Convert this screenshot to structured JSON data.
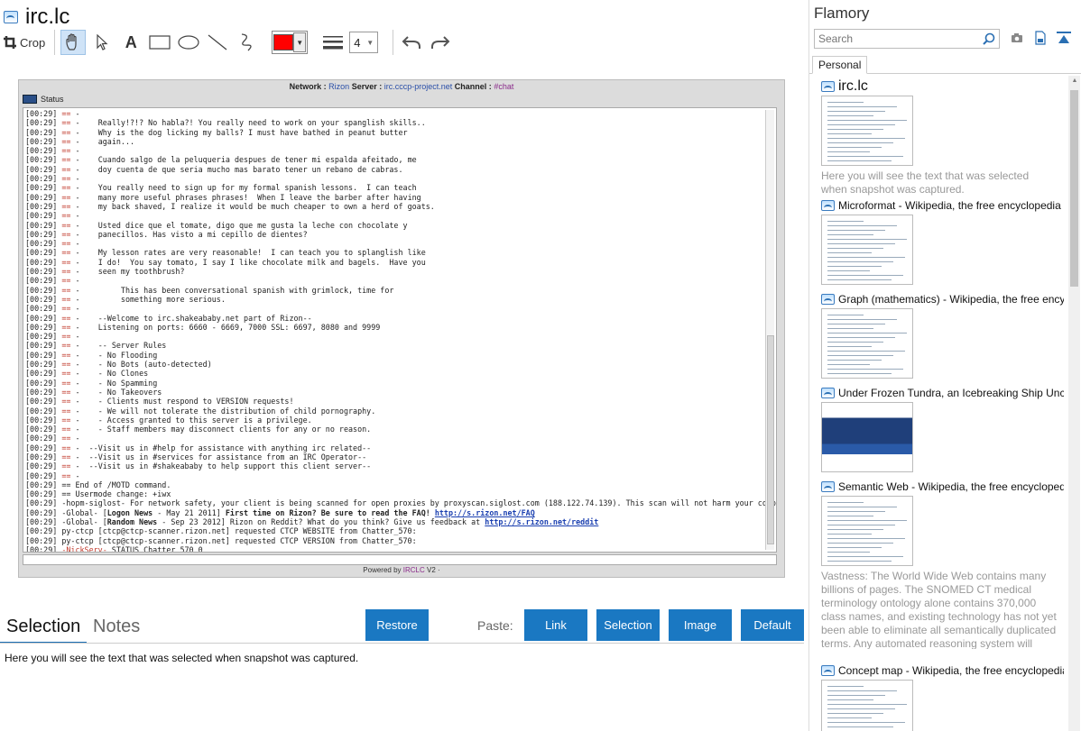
{
  "doc": {
    "title": "irc.lc"
  },
  "toolbar": {
    "crop_label": "Crop",
    "line_width": "4",
    "color": "#ff0000"
  },
  "screenshot": {
    "header": {
      "network_label": "Network :",
      "network": "Rizon",
      "server_label": "Server :",
      "server": "irc.cccp-project.net",
      "channel_label": "Channel :",
      "channel": "#chat"
    },
    "tab_status": "Status",
    "footer_prefix": "Powered by",
    "footer_brand": "IRCLC",
    "footer_suffix": "V2 ·",
    "lines": [
      {
        "t": "[00:29] ",
        "e": "== ",
        "x": "-"
      },
      {
        "t": "[00:29] ",
        "e": "== ",
        "x": "-    Really!?!? No habla?! You really need to work on your spanglish skills.."
      },
      {
        "t": "[00:29] ",
        "e": "== ",
        "x": "-    Why is the dog licking my balls? I must have bathed in peanut butter"
      },
      {
        "t": "[00:29] ",
        "e": "== ",
        "x": "-    again..."
      },
      {
        "t": "[00:29] ",
        "e": "== ",
        "x": "-"
      },
      {
        "t": "[00:29] ",
        "e": "== ",
        "x": "-    Cuando salgo de la peluqueria despues de tener mi espalda afeitado, me"
      },
      {
        "t": "[00:29] ",
        "e": "== ",
        "x": "-    doy cuenta de que seria mucho mas barato tener un rebano de cabras."
      },
      {
        "t": "[00:29] ",
        "e": "== ",
        "x": "-"
      },
      {
        "t": "[00:29] ",
        "e": "== ",
        "x": "-    You really need to sign up for my formal spanish lessons.  I can teach"
      },
      {
        "t": "[00:29] ",
        "e": "== ",
        "x": "-    many more useful phrases phrases!  When I leave the barber after having"
      },
      {
        "t": "[00:29] ",
        "e": "== ",
        "x": "-    my back shaved, I realize it would be much cheaper to own a herd of goats."
      },
      {
        "t": "[00:29] ",
        "e": "== ",
        "x": "-"
      },
      {
        "t": "[00:29] ",
        "e": "== ",
        "x": "-    Usted dice que el tomate, digo que me gusta la leche con chocolate y"
      },
      {
        "t": "[00:29] ",
        "e": "== ",
        "x": "-    panecillos. Has visto a mi cepillo de dientes?"
      },
      {
        "t": "[00:29] ",
        "e": "== ",
        "x": "-"
      },
      {
        "t": "[00:29] ",
        "e": "== ",
        "x": "-    My lesson rates are very reasonable!  I can teach you to splanglish like"
      },
      {
        "t": "[00:29] ",
        "e": "== ",
        "x": "-    I do!  You say tomato, I say I like chocolate milk and bagels.  Have you"
      },
      {
        "t": "[00:29] ",
        "e": "== ",
        "x": "-    seen my toothbrush?"
      },
      {
        "t": "[00:29] ",
        "e": "== ",
        "x": "-"
      },
      {
        "t": "[00:29] ",
        "e": "== ",
        "x": "-         This has been conversational spanish with grimlock, time for"
      },
      {
        "t": "[00:29] ",
        "e": "== ",
        "x": "-         something more serious."
      },
      {
        "t": "[00:29] ",
        "e": "== ",
        "x": "-"
      },
      {
        "t": "[00:29] ",
        "e": "== ",
        "x": "-    --Welcome to irc.shakeababy.net part of Rizon--"
      },
      {
        "t": "[00:29] ",
        "e": "== ",
        "x": "-    Listening on ports: 6660 - 6669, 7000 SSL: 6697, 8080 and 9999"
      },
      {
        "t": "[00:29] ",
        "e": "== ",
        "x": "-"
      },
      {
        "t": "[00:29] ",
        "e": "== ",
        "x": "-    -- Server Rules"
      },
      {
        "t": "[00:29] ",
        "e": "== ",
        "x": "-    - No Flooding"
      },
      {
        "t": "[00:29] ",
        "e": "== ",
        "x": "-    - No Bots (auto-detected)"
      },
      {
        "t": "[00:29] ",
        "e": "== ",
        "x": "-    - No Clones"
      },
      {
        "t": "[00:29] ",
        "e": "== ",
        "x": "-    - No Spamming"
      },
      {
        "t": "[00:29] ",
        "e": "== ",
        "x": "-    - No Takeovers"
      },
      {
        "t": "[00:29] ",
        "e": "== ",
        "x": "-    - Clients must respond to VERSION requests!"
      },
      {
        "t": "[00:29] ",
        "e": "== ",
        "x": "-    - We will not tolerate the distribution of child pornography."
      },
      {
        "t": "[00:29] ",
        "e": "== ",
        "x": "-    - Access granted to this server is a privilege."
      },
      {
        "t": "[00:29] ",
        "e": "== ",
        "x": "-    - Staff members may disconnect clients for any or no reason."
      },
      {
        "t": "[00:29] ",
        "e": "== ",
        "x": "-"
      },
      {
        "t": "[00:29] ",
        "e": "== ",
        "x": "-  --Visit us in #help for assistance with anything irc related--"
      },
      {
        "t": "[00:29] ",
        "e": "== ",
        "x": "-  --Visit us in #services for assistance from an IRC Operator--"
      },
      {
        "t": "[00:29] ",
        "e": "== ",
        "x": "-  --Visit us in #shakeababy to help support this client server--"
      },
      {
        "t": "[00:29] ",
        "e": "== ",
        "x": "-"
      },
      {
        "t": "[00:29] ",
        "e": "",
        "x": "== End of /MOTD command."
      },
      {
        "t": "[00:29] ",
        "e": "",
        "x": "== Usermode change: +iwx"
      },
      {
        "t": "[00:29] ",
        "e": "",
        "x": "-hopm-siglost- For network safety, your client is being scanned for open proxies by proxyscan.siglost.com (188.122.74.139). This scan will not harm your computer."
      },
      {
        "t": "[00:29] ",
        "e": "",
        "x": "-Global- [",
        "b": "Logon News",
        "x2": " - May 21 2011] ",
        "b2": "First time on Rizon? Be sure to read the FAQ! ",
        "l": "http://s.rizon.net/FAQ"
      },
      {
        "t": "[00:29] ",
        "e": "",
        "x": "-Global- [",
        "b": "Random News",
        "x2": " - Sep 23 2012] Rizon on Reddit? What do you think? Give us feedback at ",
        "l": "http://s.rizon.net/reddit"
      },
      {
        "t": "[00:29] ",
        "e": "",
        "x": "py-ctcp [ctcp@ctcp-scanner.rizon.net] requested CTCP WEBSITE from Chatter_570:"
      },
      {
        "t": "[00:29] ",
        "e": "",
        "x": "py-ctcp [ctcp@ctcp-scanner.rizon.net] requested CTCP VERSION from Chatter_570:"
      },
      {
        "t": "[00:29] ",
        "e": "",
        "n": "-NickServ-",
        "x": " STATUS Chatter_570 0"
      }
    ]
  },
  "bottom": {
    "tab_selection": "Selection",
    "tab_notes": "Notes",
    "restore": "Restore",
    "paste_label": "Paste:",
    "link": "Link",
    "selection": "Selection",
    "image": "Image",
    "default": "Default",
    "selected_text": "Here you will see the text that was selected when snapshot was captured."
  },
  "sidebar": {
    "title": "Flamory",
    "search_placeholder": "Search",
    "tab_personal": "Personal",
    "snapshots": [
      {
        "title": "irc.lc",
        "desc": "Here you will see the text that was selected when snapshot was captured."
      },
      {
        "title": "Microformat - Wikipedia, the free encyclopedia",
        "desc": ""
      },
      {
        "title": "Graph (mathematics) - Wikipedia, the free encyclopedia",
        "desc": ""
      },
      {
        "title": "Under Frozen Tundra, an Icebreaking Ship Uncovers",
        "desc": ""
      },
      {
        "title": "Semantic Web - Wikipedia, the free encyclopedia",
        "desc": "Vastness: The World Wide Web contains many billions of pages. The SNOMED CT medical terminology ontology alone contains 370,000 class names, and existing technology has not yet been able to eliminate all semantically duplicated terms. Any automated reasoning system will have to deal with truly huge inputs."
      },
      {
        "title": "Concept map - Wikipedia, the free encyclopedia",
        "desc": ""
      }
    ]
  }
}
